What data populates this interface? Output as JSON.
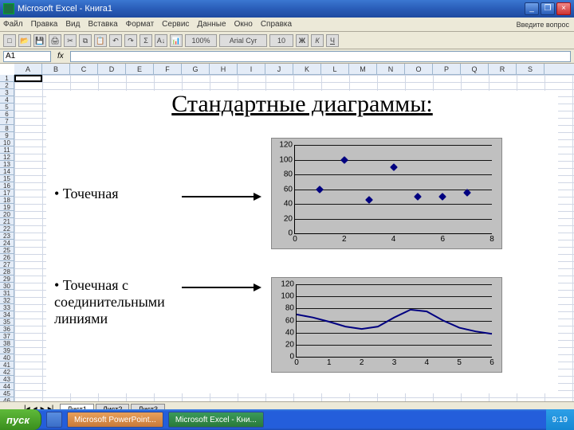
{
  "window": {
    "title": "Microsoft Excel - Книга1"
  },
  "menu": {
    "items": [
      "Файл",
      "Правка",
      "Вид",
      "Вставка",
      "Формат",
      "Сервис",
      "Данные",
      "Окно",
      "Справка"
    ],
    "question": "Введите вопрос"
  },
  "formula": {
    "namebox": "A1"
  },
  "columns": [
    "A",
    "B",
    "C",
    "D",
    "E",
    "F",
    "G",
    "H",
    "I",
    "J",
    "K",
    "L",
    "M",
    "N",
    "O",
    "P",
    "Q",
    "R",
    "S"
  ],
  "slide": {
    "title": "Стандартные диаграммы:",
    "bullet1": "• Точечная",
    "bullet2": "• Точечная с соединительными линиями"
  },
  "sheets": {
    "tab1": "Лист1",
    "tab2": "Лист2",
    "tab3": "Лист3"
  },
  "taskbar": {
    "start": "пуск",
    "btn1": "",
    "btn2": "Microsoft PowerPoint...",
    "btn3": "Microsoft Excel - Кни...",
    "time": "9:19"
  },
  "chart_data": [
    {
      "type": "scatter",
      "title": "",
      "xlabel": "",
      "ylabel": "",
      "xlim": [
        0,
        8
      ],
      "ylim": [
        0,
        120
      ],
      "xticks": [
        0,
        2,
        4,
        6,
        8
      ],
      "yticks": [
        0,
        20,
        40,
        60,
        80,
        100,
        120
      ],
      "series": [
        {
          "name": "",
          "x": [
            1,
            2,
            3,
            4,
            5,
            6,
            7
          ],
          "y": [
            60,
            100,
            45,
            90,
            50,
            50,
            55
          ]
        }
      ]
    },
    {
      "type": "line",
      "title": "",
      "xlabel": "",
      "ylabel": "",
      "xlim": [
        0,
        6
      ],
      "ylim": [
        0,
        120
      ],
      "xticks": [
        0,
        1,
        2,
        3,
        4,
        5,
        6
      ],
      "yticks": [
        0,
        20,
        40,
        60,
        80,
        100,
        120
      ],
      "series": [
        {
          "name": "",
          "x": [
            0,
            0.5,
            1,
            1.5,
            2,
            2.5,
            3,
            3.5,
            4,
            4.5,
            5,
            5.5,
            6
          ],
          "y": [
            70,
            65,
            58,
            50,
            46,
            50,
            65,
            78,
            75,
            60,
            48,
            42,
            38
          ]
        }
      ]
    }
  ]
}
